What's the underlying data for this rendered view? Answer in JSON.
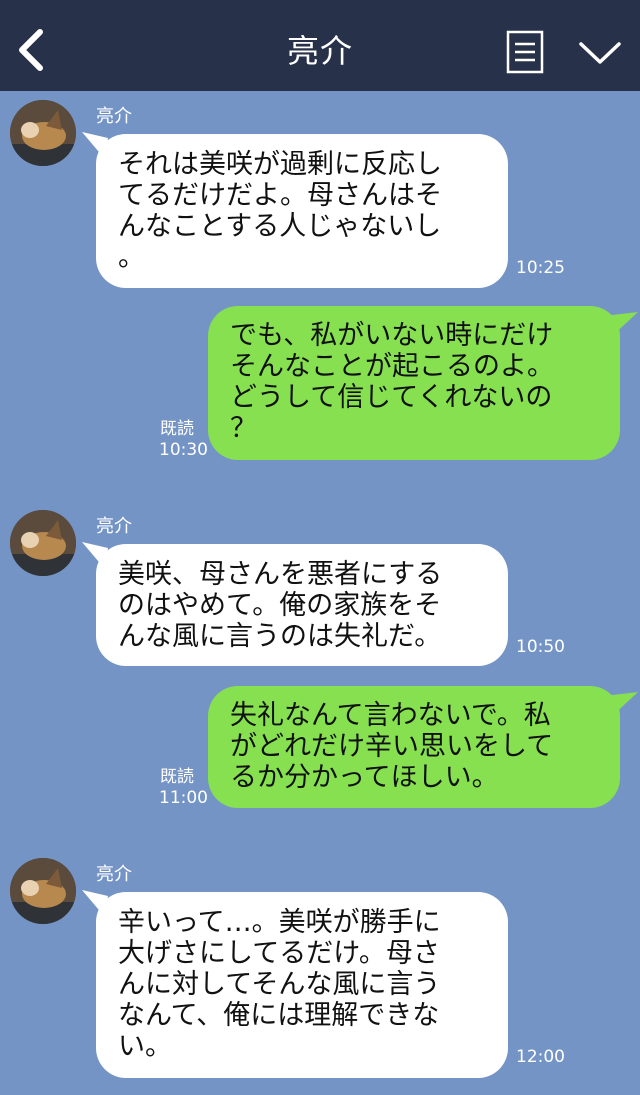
{
  "header": {
    "title": "亮介"
  },
  "messages": [
    {
      "direction": "incoming",
      "sender": "亮介",
      "text": "それは美咲が過剰に反応し\nてるだけだよ。母さんはそ\nんなことする人じゃないし\n。",
      "time": "10:25"
    },
    {
      "direction": "outgoing",
      "text": "でも、私がいない時にだけ\nそんなことが起こるのよ。\nどうして信じてくれないの\n？",
      "read_label": "既読",
      "time": "10:30"
    },
    {
      "direction": "incoming",
      "sender": "亮介",
      "text": "美咲、母さんを悪者にする\nのはやめて。俺の家族をそ\nんな風に言うのは失礼だ。",
      "time": "10:50"
    },
    {
      "direction": "outgoing",
      "text": "失礼なんて言わないで。私\nがどれだけ辛い思いをして\nるか分かってほしい。",
      "read_label": "既読",
      "time": "11:00"
    },
    {
      "direction": "incoming",
      "sender": "亮介",
      "text": "辛いって…。美咲が勝手に\n大げさにしてるだけ。母さ\nんに対してそんな風に言う\nなんて、俺には理解できな\nい。",
      "time": "12:00"
    }
  ],
  "colors": {
    "header_bg": "#27324a",
    "chat_bg": "#7494c6",
    "incoming_bubble": "#ffffff",
    "outgoing_bubble": "#86e050"
  },
  "icons": [
    "back-icon",
    "notes-icon",
    "chevron-down-icon",
    "avatar"
  ]
}
